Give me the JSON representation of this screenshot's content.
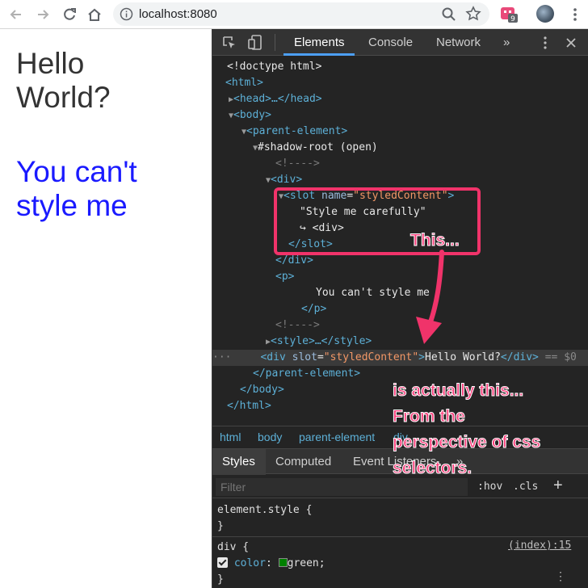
{
  "browser": {
    "url": "localhost:8080",
    "icons": [
      "back-arrow-icon",
      "forward-arrow-icon",
      "reload-icon",
      "home-icon",
      "info-icon",
      "zoom-icon",
      "star-icon",
      "extension-icon",
      "avatar",
      "kebab-menu-icon"
    ]
  },
  "page": {
    "heading": "Hello World?",
    "paragraph": "You can't style me"
  },
  "devtools": {
    "tabs": [
      "Elements",
      "Console",
      "Network",
      "»"
    ],
    "active_tab": "Elements",
    "tree": {
      "doctype": "<!doctype html>",
      "html_open": "<html>",
      "head": "<head>…</head>",
      "body_open": "<body>",
      "parent_open": "<parent-element>",
      "shadow_root": "#shadow-root (open)",
      "comment1": "<!---->",
      "div_open": "<div>",
      "slot_tag": "<slot",
      "slot_attr_name": "name",
      "slot_attr_val": "\"styledContent\"",
      "slot_close_bracket": ">",
      "slot_text": "\"Style me carefully\"",
      "slot_div_ref": "↪ <div>",
      "slot_close": "</slot>",
      "div_close": "</div>",
      "p_open": "<p>",
      "p_text": "You can't style me",
      "p_close": "</p>",
      "comment2": "<!---->",
      "style": "<style>…</style>",
      "sel_tag": "<div",
      "sel_attr_name": "slot",
      "sel_attr_val": "\"styledContent\"",
      "sel_text": "Hello World?",
      "sel_close": "</div>",
      "sel_suffix": "== $0",
      "parent_close": "</parent-element>",
      "body_close": "</body>",
      "html_close": "</html>"
    },
    "breadcrumbs": [
      "html",
      "body",
      "parent-element",
      "div"
    ],
    "subtabs": [
      "Styles",
      "Computed",
      "Event Listeners",
      "»"
    ],
    "filter_placeholder": "Filter",
    "hov": ":hov",
    "cls": ".cls",
    "plus": "+",
    "rules": {
      "element_style": "element.style {",
      "close1": "}",
      "div_selector": "div {",
      "source": "(index):15",
      "prop_name": "color",
      "prop_value": "green;",
      "close2": "}"
    }
  },
  "annotations": {
    "this": "This...",
    "is_actually": "is actually this...",
    "from_the": "From the",
    "perspective": "perspective of css",
    "selectors": "selectors."
  },
  "colors": {
    "annotation": "#f0336a",
    "link_blue": "#1a1aff",
    "devtools_bg": "#242424",
    "tag": "#5db0d7",
    "attr_value": "#f29766"
  }
}
